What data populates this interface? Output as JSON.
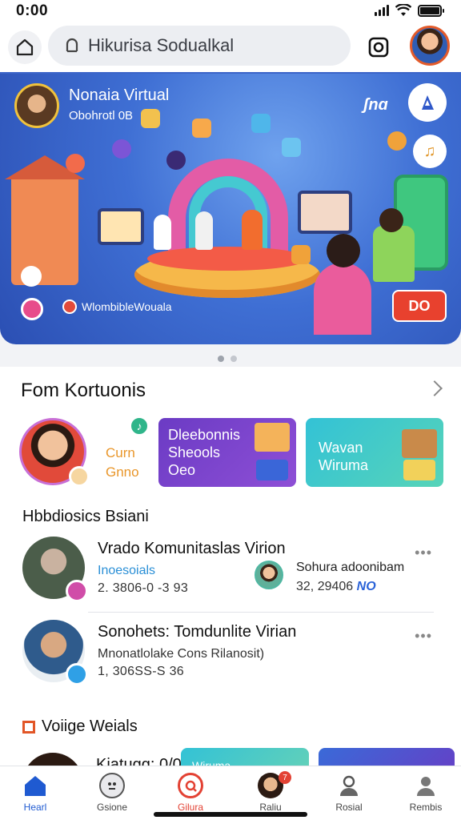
{
  "status": {
    "time": "0:00"
  },
  "search": {
    "text": "Hikurisa Sodualkal"
  },
  "hero": {
    "title": "Nonaia Virtual",
    "subtitle": "Obohrotl 0B",
    "logo": "ʃnɑ",
    "caption": "WlombibleWouala",
    "cta": "DO"
  },
  "section": {
    "title": "Fom Kortuonis",
    "featured": {
      "line1": "Curn",
      "line2": "Gnno"
    },
    "card_purple": {
      "line1": "Dleebonnis",
      "line2": "Sheools",
      "line3": "Oeo"
    },
    "card_teal": {
      "line1": "Wavan",
      "line2": "Wiruma"
    }
  },
  "panel": {
    "title": "Hbbdiosics Bsiani",
    "items": [
      {
        "title": "Vrado Komunitaslas Virion",
        "subtitle": "Inoesoials",
        "meta": "2. 3806-0 -3 93",
        "side_title": "Sohura adoonibam",
        "side_meta": "32, 29406",
        "side_tag": "NO"
      },
      {
        "title": "Sonohets: Tomdunlite Virian",
        "subtitle": "Mnonatlolake Cons Rilanosit)",
        "meta": "1, 306SS-S 36"
      }
    ],
    "more": "•••"
  },
  "promo": {
    "title": "Voiige Weials",
    "label": "Kiatugg: 0/0",
    "card_text": "Wiruma"
  },
  "tabs": [
    {
      "label": "Hearl",
      "icon": "home-icon"
    },
    {
      "label": "Gsione",
      "icon": "robot-icon"
    },
    {
      "label": "Gilura",
      "icon": "live-icon"
    },
    {
      "label": "Raliu",
      "icon": "avatar-icon",
      "badge": "7"
    },
    {
      "label": "Rosial",
      "icon": "person-icon"
    },
    {
      "label": "Rembis",
      "icon": "profile-icon"
    }
  ],
  "colors": {
    "accent": "#1f5ad1",
    "brand_red": "#e8412e",
    "hero_blue": "#3f6fd4",
    "teal": "#33c2d6",
    "purple": "#6b3bc4"
  }
}
